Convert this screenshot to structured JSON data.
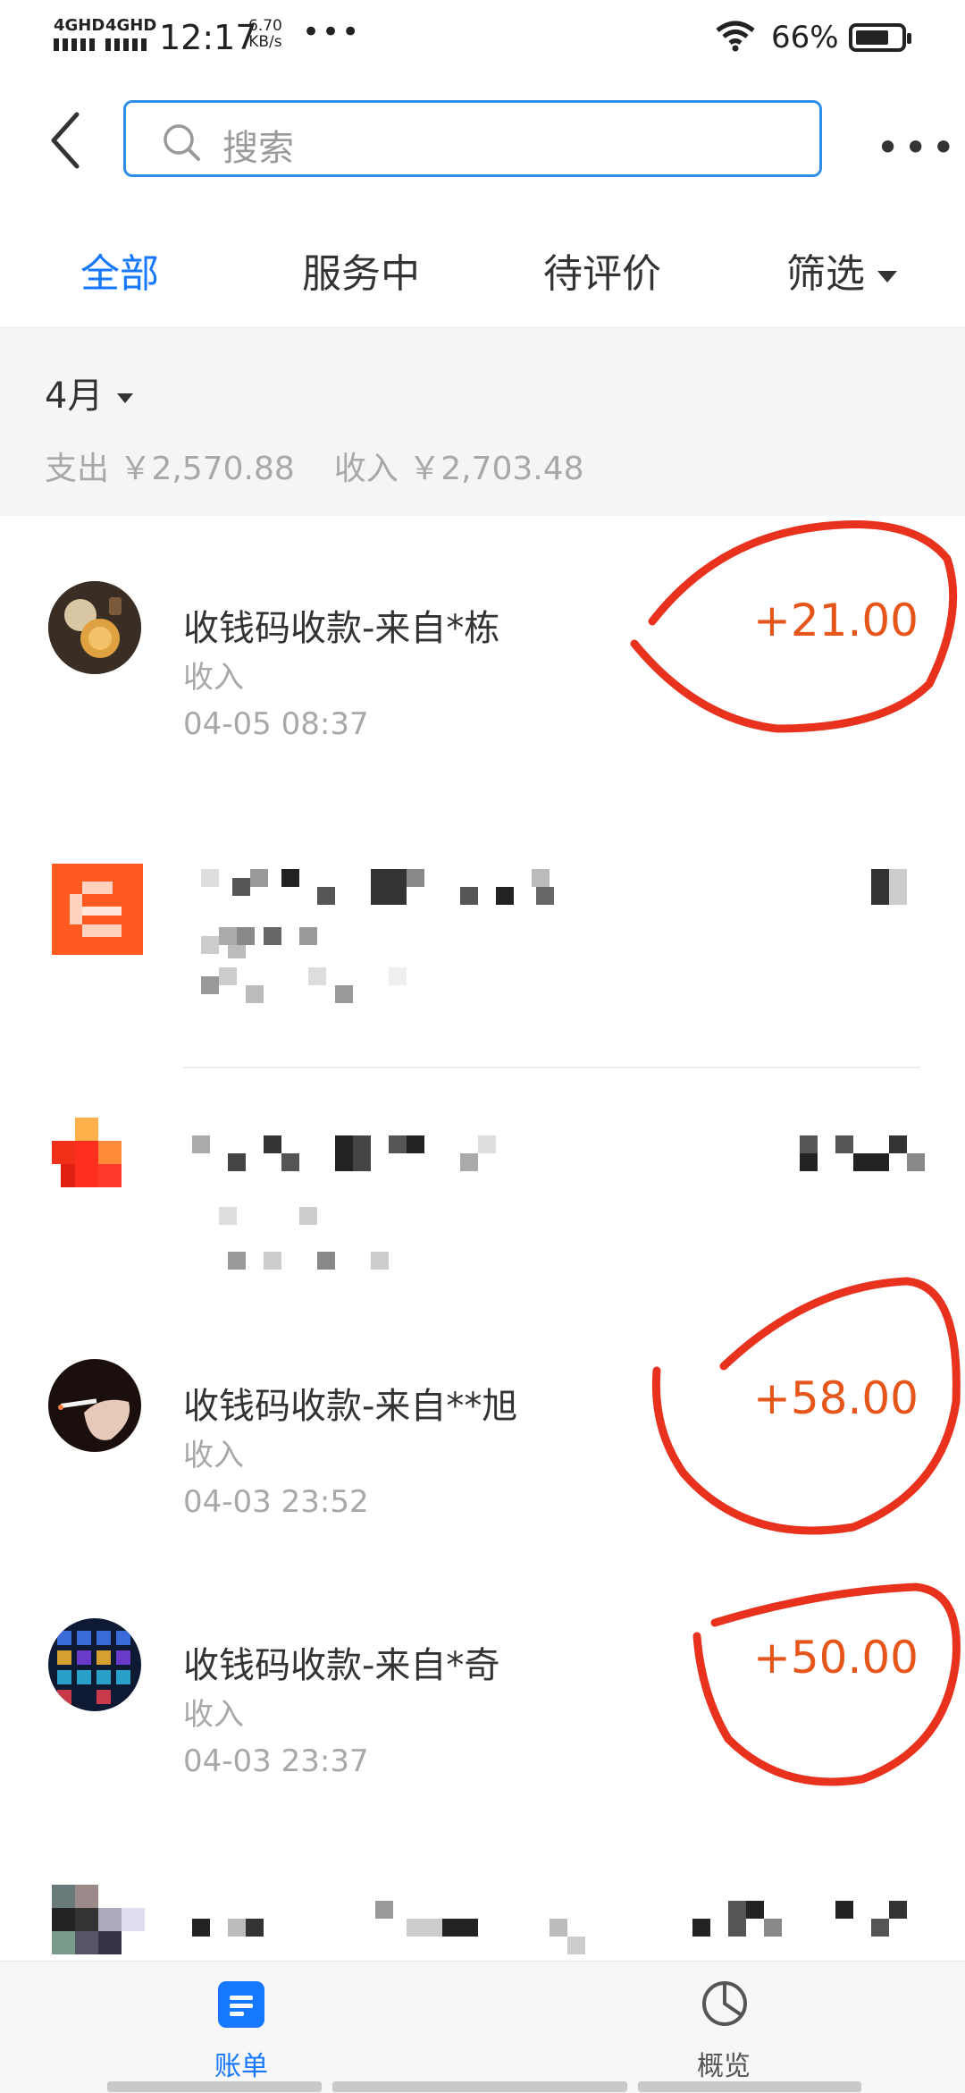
{
  "status_bar": {
    "sim1": "4GHD",
    "sim2": "4GHD",
    "time": "12:17",
    "speed_value": "6.70",
    "speed_unit": "KB/s",
    "more": "•••",
    "battery": "66%"
  },
  "header": {
    "search_placeholder": "搜索",
    "more": "•••"
  },
  "tabs": [
    {
      "label": "全部",
      "active": true
    },
    {
      "label": "服务中",
      "active": false
    },
    {
      "label": "待评价",
      "active": false
    },
    {
      "label": "筛选",
      "active": false
    }
  ],
  "month": {
    "label": "4月",
    "expense": "支出 ￥2,570.88",
    "income": "收入 ￥2,703.48"
  },
  "transactions": [
    {
      "title": "收钱码收款-来自*栋",
      "type": "收入",
      "date": "04-05  08:37",
      "amount": "+21.00"
    },
    {
      "title": "收钱码收款-来自**旭",
      "type": "收入",
      "date": "04-03  23:52",
      "amount": "+58.00"
    },
    {
      "title": "收钱码收款-来自*奇",
      "type": "收入",
      "date": "04-03  23:37",
      "amount": "+50.00"
    }
  ],
  "bottom_nav": [
    {
      "label": "账单",
      "icon": "bill-icon",
      "active": true
    },
    {
      "label": "概览",
      "icon": "pie-chart-icon",
      "active": false
    }
  ],
  "colors": {
    "accent": "#1677ff",
    "amount": "#e6561a",
    "annotation": "#e8321e"
  }
}
